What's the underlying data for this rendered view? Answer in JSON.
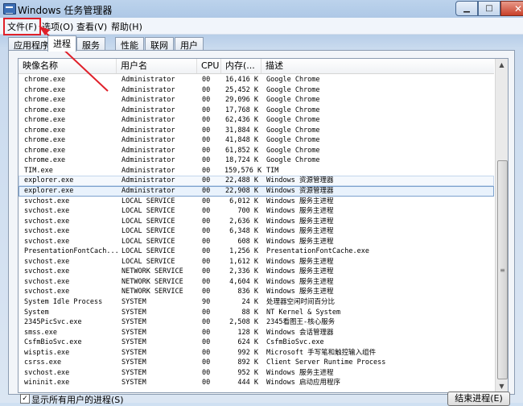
{
  "window": {
    "title": "Windows 任务管理器",
    "minimize_icon": "minimize-icon",
    "maximize_icon": "maximize-icon",
    "close_icon": "close-icon"
  },
  "menu": [
    {
      "label": "文件(F)",
      "highlighted": true
    },
    {
      "label": "选项(O)"
    },
    {
      "label": "查看(V)"
    },
    {
      "label": "帮助(H)"
    }
  ],
  "tabs": [
    {
      "label": "应用程序"
    },
    {
      "label": "进程",
      "active": true
    },
    {
      "label": "服务"
    },
    {
      "label": "性能"
    },
    {
      "label": "联网"
    },
    {
      "label": "用户"
    }
  ],
  "columns": {
    "name": "映像名称",
    "user": "用户名",
    "cpu": "CPU",
    "mem": "内存(...",
    "desc": "描述"
  },
  "processes": [
    {
      "name": "chrome.exe",
      "user": "Administrator",
      "cpu": "00",
      "mem": "16,416 K",
      "desc": "Google Chrome"
    },
    {
      "name": "chrome.exe",
      "user": "Administrator",
      "cpu": "00",
      "mem": "25,452 K",
      "desc": "Google Chrome"
    },
    {
      "name": "chrome.exe",
      "user": "Administrator",
      "cpu": "00",
      "mem": "29,096 K",
      "desc": "Google Chrome"
    },
    {
      "name": "chrome.exe",
      "user": "Administrator",
      "cpu": "00",
      "mem": "17,768 K",
      "desc": "Google Chrome"
    },
    {
      "name": "chrome.exe",
      "user": "Administrator",
      "cpu": "00",
      "mem": "62,436 K",
      "desc": "Google Chrome"
    },
    {
      "name": "chrome.exe",
      "user": "Administrator",
      "cpu": "00",
      "mem": "31,884 K",
      "desc": "Google Chrome"
    },
    {
      "name": "chrome.exe",
      "user": "Administrator",
      "cpu": "00",
      "mem": "41,848 K",
      "desc": "Google Chrome"
    },
    {
      "name": "chrome.exe",
      "user": "Administrator",
      "cpu": "00",
      "mem": "61,852 K",
      "desc": "Google Chrome"
    },
    {
      "name": "chrome.exe",
      "user": "Administrator",
      "cpu": "00",
      "mem": "18,724 K",
      "desc": "Google Chrome"
    },
    {
      "name": "TIM.exe",
      "user": "Administrator",
      "cpu": "00",
      "mem": "159,576 K",
      "desc": "TIM"
    },
    {
      "name": "explorer.exe",
      "user": "Administrator",
      "cpu": "00",
      "mem": "22,488 K",
      "desc": "Windows 资源管理器",
      "state": "hover"
    },
    {
      "name": "explorer.exe",
      "user": "Administrator",
      "cpu": "00",
      "mem": "22,908 K",
      "desc": "Windows 资源管理器",
      "state": "selected"
    },
    {
      "name": "svchost.exe",
      "user": "LOCAL SERVICE",
      "cpu": "00",
      "mem": "6,012 K",
      "desc": "Windows 服务主进程"
    },
    {
      "name": "svchost.exe",
      "user": "LOCAL SERVICE",
      "cpu": "00",
      "mem": "700 K",
      "desc": "Windows 服务主进程"
    },
    {
      "name": "svchost.exe",
      "user": "LOCAL SERVICE",
      "cpu": "00",
      "mem": "2,636 K",
      "desc": "Windows 服务主进程"
    },
    {
      "name": "svchost.exe",
      "user": "LOCAL SERVICE",
      "cpu": "00",
      "mem": "6,348 K",
      "desc": "Windows 服务主进程"
    },
    {
      "name": "svchost.exe",
      "user": "LOCAL SERVICE",
      "cpu": "00",
      "mem": "608 K",
      "desc": "Windows 服务主进程"
    },
    {
      "name": "PresentationFontCach...",
      "user": "LOCAL SERVICE",
      "cpu": "00",
      "mem": "1,256 K",
      "desc": "PresentationFontCache.exe"
    },
    {
      "name": "svchost.exe",
      "user": "LOCAL SERVICE",
      "cpu": "00",
      "mem": "1,612 K",
      "desc": "Windows 服务主进程"
    },
    {
      "name": "svchost.exe",
      "user": "NETWORK SERVICE",
      "cpu": "00",
      "mem": "2,336 K",
      "desc": "Windows 服务主进程"
    },
    {
      "name": "svchost.exe",
      "user": "NETWORK SERVICE",
      "cpu": "00",
      "mem": "4,604 K",
      "desc": "Windows 服务主进程"
    },
    {
      "name": "svchost.exe",
      "user": "NETWORK SERVICE",
      "cpu": "00",
      "mem": "836 K",
      "desc": "Windows 服务主进程"
    },
    {
      "name": "System Idle Process",
      "user": "SYSTEM",
      "cpu": "90",
      "mem": "24 K",
      "desc": "处理器空闲时间百分比"
    },
    {
      "name": "System",
      "user": "SYSTEM",
      "cpu": "00",
      "mem": "88 K",
      "desc": "NT Kernel & System"
    },
    {
      "name": "2345PicSvc.exe",
      "user": "SYSTEM",
      "cpu": "00",
      "mem": "2,508 K",
      "desc": "2345看图王-核心服务"
    },
    {
      "name": "smss.exe",
      "user": "SYSTEM",
      "cpu": "00",
      "mem": "128 K",
      "desc": "Windows 会话管理器"
    },
    {
      "name": "CsfmBioSvc.exe",
      "user": "SYSTEM",
      "cpu": "00",
      "mem": "624 K",
      "desc": "CsfmBioSvc.exe"
    },
    {
      "name": "wisptis.exe",
      "user": "SYSTEM",
      "cpu": "00",
      "mem": "992 K",
      "desc": "Microsoft 手写笔和触控输入组件"
    },
    {
      "name": "csrss.exe",
      "user": "SYSTEM",
      "cpu": "00",
      "mem": "892 K",
      "desc": "Client Server Runtime Process"
    },
    {
      "name": "svchost.exe",
      "user": "SYSTEM",
      "cpu": "00",
      "mem": "952 K",
      "desc": "Windows 服务主进程"
    },
    {
      "name": "wininit.exe",
      "user": "SYSTEM",
      "cpu": "00",
      "mem": "444 K",
      "desc": "Windows 启动应用程序"
    }
  ],
  "footer": {
    "show_all_label": "显示所有用户的进程(S)",
    "end_process_label": "结束进程(E)",
    "show_all_checked": true
  },
  "colors": {
    "highlight_box": "#e0202a",
    "annotation_arrow": "#e0202a",
    "selection": "#7da2ce"
  }
}
